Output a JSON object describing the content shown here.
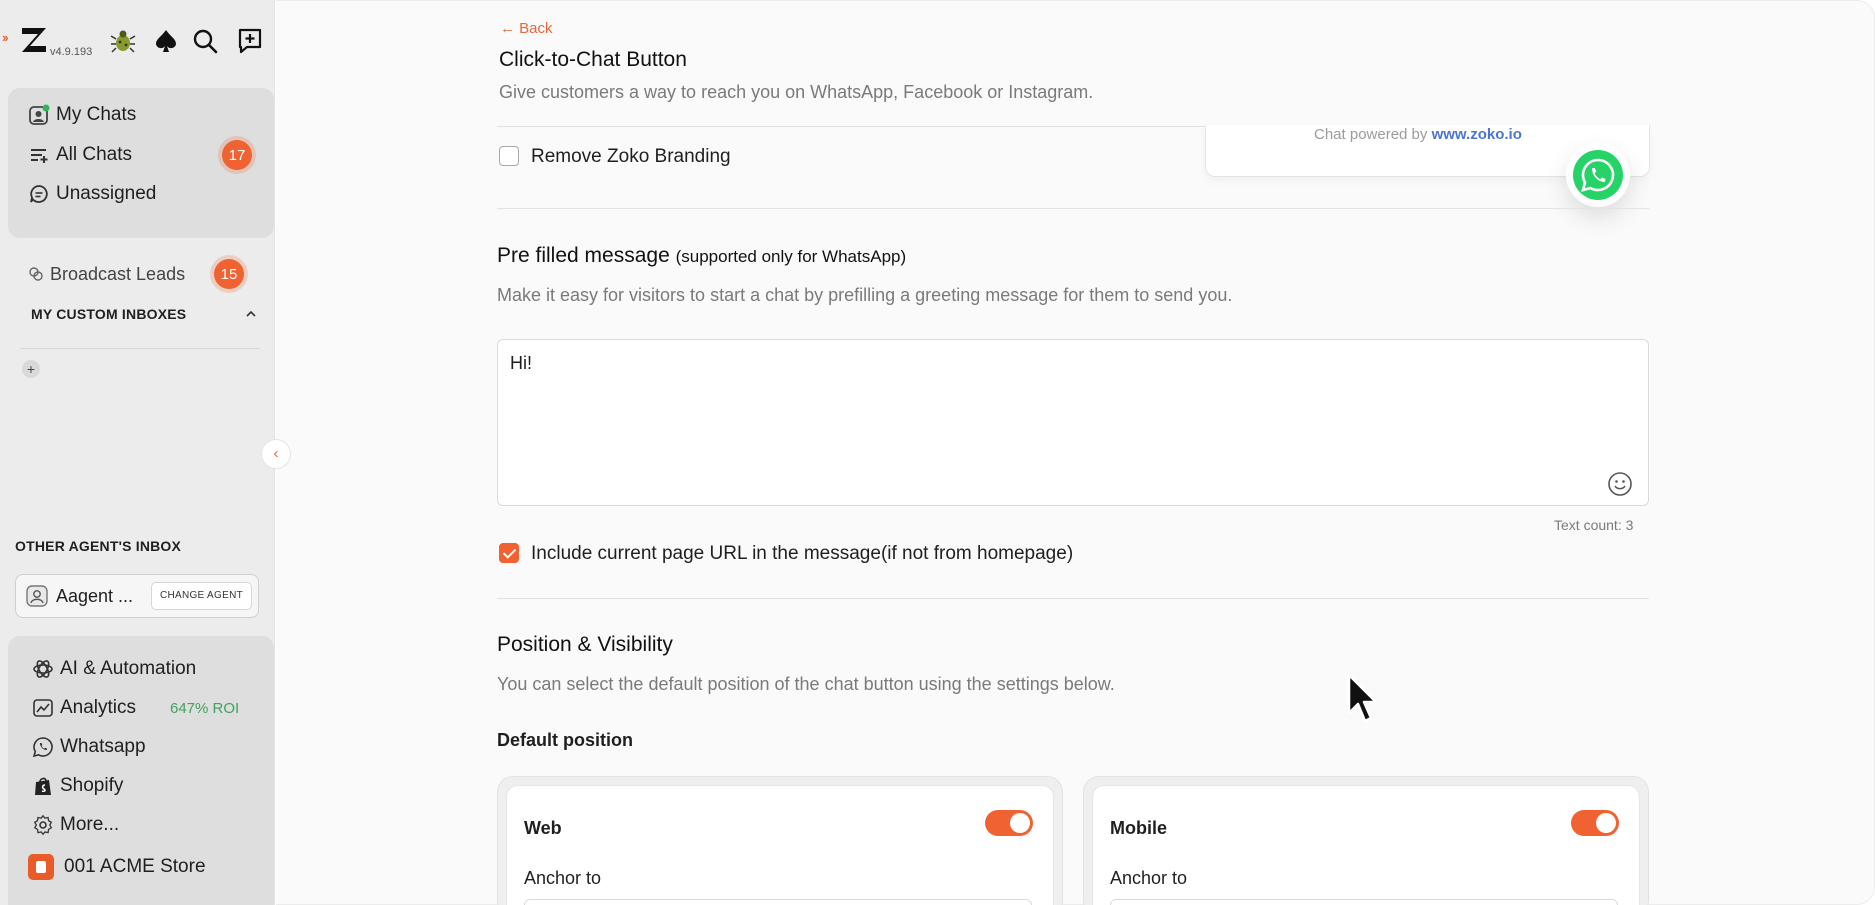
{
  "app": {
    "version": "v4.9.193"
  },
  "sidebar": {
    "nav": [
      {
        "label": "My Chats"
      },
      {
        "label": "All Chats",
        "badge": "17"
      },
      {
        "label": "Unassigned"
      }
    ],
    "broadcast": {
      "label": "Broadcast Leads",
      "badge": "15"
    },
    "custom_inboxes_title": "MY CUSTOM INBOXES",
    "other_inbox_title": "OTHER AGENT'S INBOX",
    "agent_name": "Aagent ...",
    "change_agent": "CHANGE AGENT",
    "bottom": [
      {
        "label": "AI & Automation"
      },
      {
        "label": "Analytics",
        "extra": "647% ROI"
      },
      {
        "label": "Whatsapp"
      },
      {
        "label": "Shopify"
      },
      {
        "label": "More..."
      }
    ],
    "store": "001 ACME Store"
  },
  "main": {
    "back": "Back",
    "title": "Click-to-Chat Button",
    "subtitle": "Give customers a way to reach you on WhatsApp, Facebook or Instagram.",
    "remove_branding": "Remove Zoko Branding",
    "preview": {
      "powered_prefix": "Chat powered by",
      "powered_link": "www.zoko.io"
    },
    "prefilled": {
      "title": "Pre filled message",
      "title_note": "(supported only for WhatsApp)",
      "desc": "Make it easy for visitors to start a chat by prefilling a greeting message for them to send you.",
      "message": "Hi!",
      "text_count": "Text count: 3",
      "include_url": "Include current page URL in the message(if not from homepage)"
    },
    "position": {
      "title": "Position & Visibility",
      "desc": "You can select the default position of the chat button using the settings below.",
      "default_label": "Default position",
      "cards": [
        {
          "title": "Web",
          "anchor_label": "Anchor to",
          "enabled": true
        },
        {
          "title": "Mobile",
          "anchor_label": "Anchor to",
          "enabled": true
        }
      ]
    }
  },
  "colors": {
    "accent": "#f06232",
    "roi": "#3ea45f",
    "link": "#4a76d1",
    "whatsapp": "#25d366"
  }
}
